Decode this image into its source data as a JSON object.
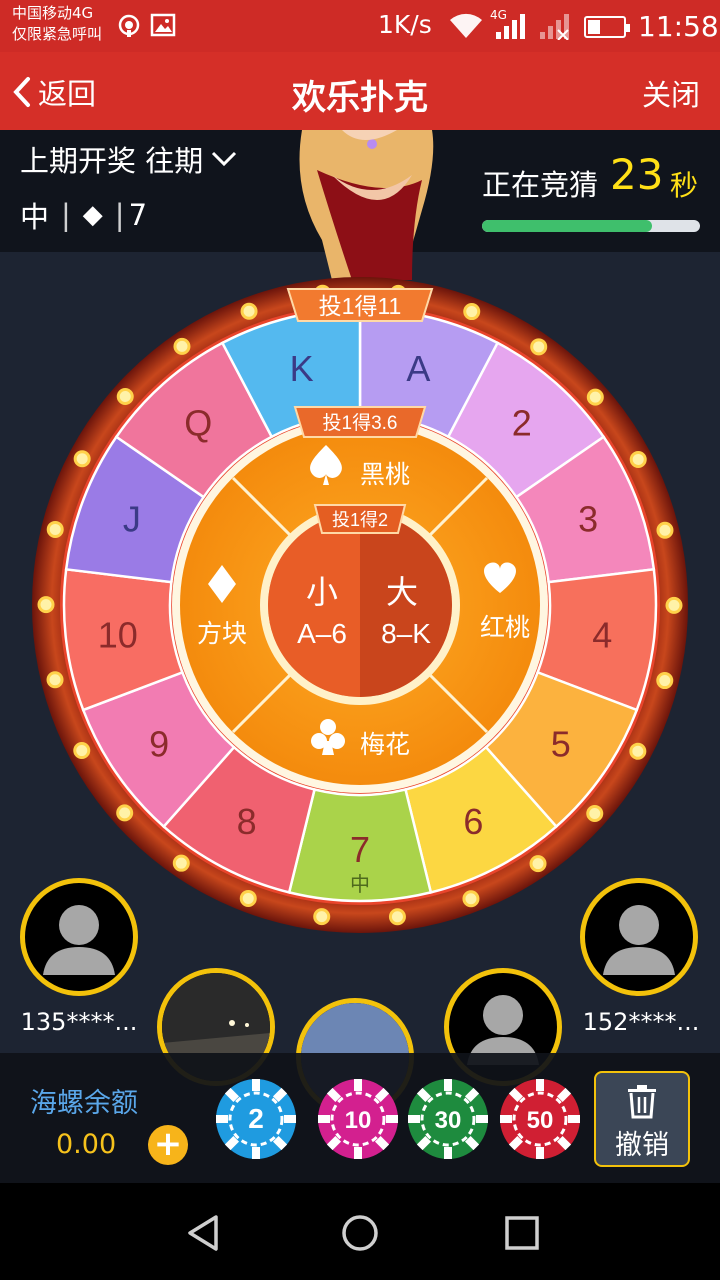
{
  "status_bar": {
    "carrier": "中国移动4G",
    "emergency": "仅限紧急呼叫",
    "speed": "1K/s",
    "network": "4G",
    "time": "11:58"
  },
  "title_bar": {
    "back_label": "返回",
    "title": "欢乐扑克",
    "close_label": "关闭"
  },
  "info": {
    "last_draw_label": "上期开奖 往期",
    "result_size": "中",
    "result_suit": "◆",
    "result_rank": "7",
    "guessing_label": "正在竞猜",
    "countdown": "23",
    "countdown_unit": "秒",
    "progress": 0.78
  },
  "wheel": {
    "outer_odds": "投1得11",
    "middle_odds": "投1得3.6",
    "inner_odds": "投1得2",
    "ranks": [
      "A",
      "2",
      "3",
      "4",
      "5",
      "6",
      "7",
      "8",
      "9",
      "10",
      "J",
      "Q",
      "K"
    ],
    "rank_colors": [
      "#b69cf2",
      "#e6a6ef",
      "#f487bb",
      "#f7705c",
      "#fcb23e",
      "#fcd742",
      "#aad34a",
      "#f06170",
      "#f27cb2",
      "#f86d63",
      "#9a7be6",
      "#f0759c",
      "#54b9ef"
    ],
    "current_rank_tag": "中",
    "suits": {
      "spade": "黑桃",
      "heart": "红桃",
      "club": "梅花",
      "diamond": "方块"
    },
    "small": {
      "label": "小",
      "range": "A–6"
    },
    "big": {
      "label": "大",
      "range": "8–K"
    }
  },
  "players": [
    {
      "name": "135****..."
    },
    {
      "name": "152****..."
    }
  ],
  "bet_bar": {
    "balance_label": "海螺余额",
    "balance": "0.00",
    "chips": [
      {
        "value": "2",
        "color": "#1f9be0"
      },
      {
        "value": "10",
        "color": "#d3208f"
      },
      {
        "value": "30",
        "color": "#1e8b3e"
      },
      {
        "value": "50",
        "color": "#d01f33"
      }
    ],
    "cancel_label": "撤销"
  }
}
